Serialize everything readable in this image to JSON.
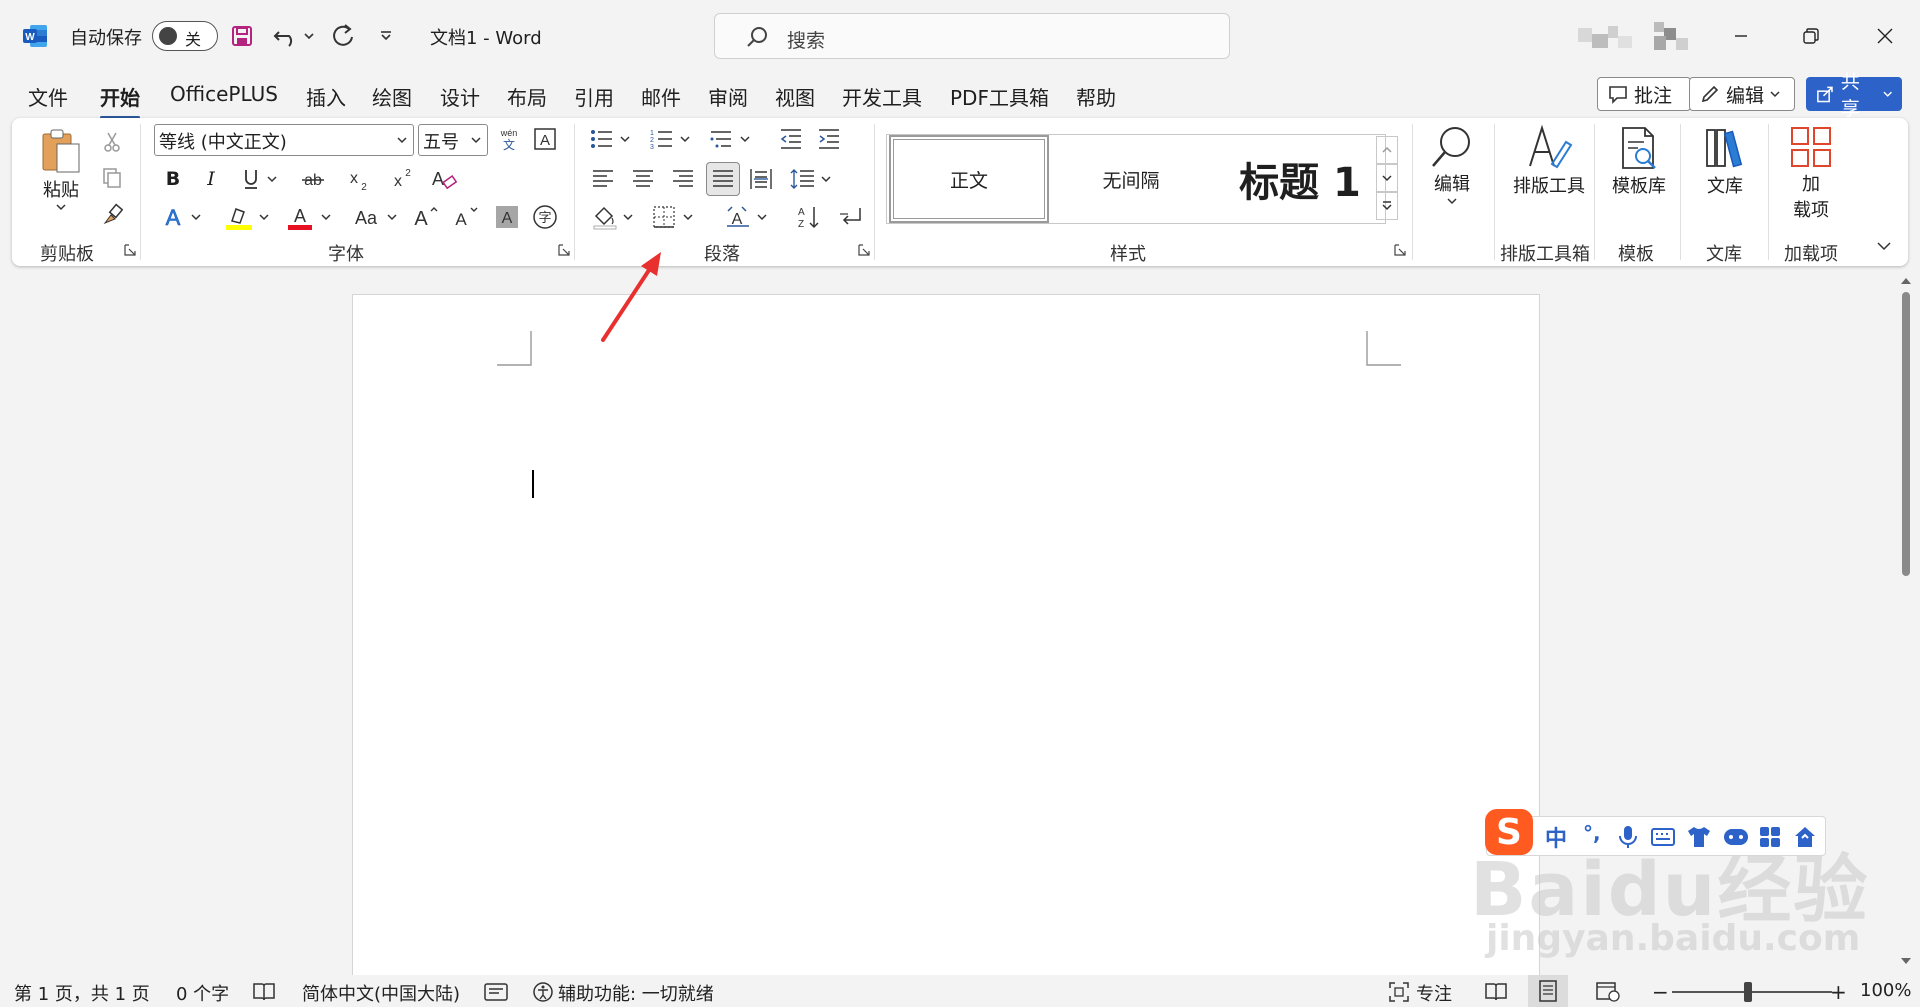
{
  "titlebar": {
    "app_icon": "word-logo",
    "autosave_label": "自动保存",
    "autosave_state": "关",
    "doc_title": "文档1  -  Word",
    "search_placeholder": "搜索"
  },
  "menu": {
    "tabs": [
      "文件",
      "开始",
      "OfficePLUS",
      "插入",
      "绘图",
      "设计",
      "布局",
      "引用",
      "邮件",
      "审阅",
      "视图",
      "开发工具",
      "PDF工具箱",
      "帮助"
    ],
    "active_tab": "开始",
    "comments_label": "批注",
    "editing_label": "编辑",
    "share_label": "共享"
  },
  "ribbon": {
    "clipboard": {
      "paste_label": "粘贴",
      "group_label": "剪贴板"
    },
    "font": {
      "font_name": "等线 (中文正文)",
      "font_size": "五号",
      "group_label": "字体",
      "underline_color": "#ffff00",
      "font_color": "#e81123"
    },
    "paragraph": {
      "group_label": "段落"
    },
    "styles": {
      "normal": "正文",
      "no_spacing": "无间隔",
      "heading1": "标题 1",
      "group_label": "样式"
    },
    "editing": {
      "label": "编辑"
    },
    "layout_tools": {
      "label": "排版工具",
      "group_label": "排版工具箱"
    },
    "templates": {
      "label": "模板库",
      "group_label": "模板"
    },
    "library": {
      "label": "文库",
      "group_label": "文库"
    },
    "addins": {
      "label_line1": "加",
      "label_line2": "载项",
      "group_label": "加载项"
    }
  },
  "ime": {
    "mode": "中",
    "punct": "°,"
  },
  "watermark": {
    "line1": "Baidu经验",
    "line2": "jingyan.baidu.com"
  },
  "statusbar": {
    "page": "第 1 页，共 1 页",
    "words": "0 个字",
    "language": "简体中文(中国大陆)",
    "accessibility": "辅助功能: 一切就绪",
    "focus": "专注",
    "zoom": "100%"
  },
  "colors": {
    "accent": "#2b579a",
    "share_bg": "#2d62c8",
    "annotation_arrow": "#e8312f",
    "ime_brand": "#ff5a1f"
  }
}
